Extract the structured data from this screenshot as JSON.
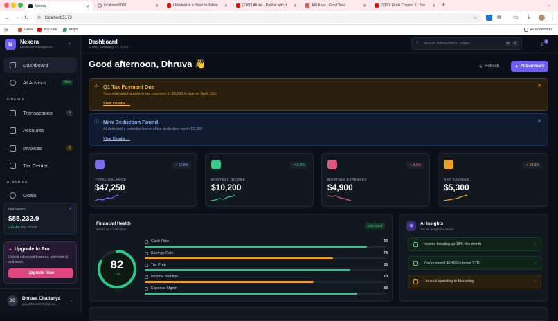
{
  "browser": {
    "tabs": [
      {
        "title": "Nexora",
        "active": true,
        "icon": "nexora-icon"
      },
      {
        "title": "localhost:8000",
        "active": false,
        "icon": "globe-icon"
      },
      {
        "title": "I Worked at a Hotel for Billion",
        "active": false,
        "icon": "youtube-icon"
      },
      {
        "title": "(1360) Afusic - Pal Pal with d",
        "active": false,
        "icon": "youtube-icon"
      },
      {
        "title": "API Keys - GroqCloud",
        "active": false,
        "icon": "groq-icon"
      },
      {
        "title": "(1360) Ekaki Chapter 5 : The",
        "active": false,
        "icon": "youtube-icon"
      }
    ],
    "url": "localhost:5173",
    "bookmarks": [
      "Gmail",
      "YouTube",
      "Maps"
    ],
    "all_bookmarks": "All Bookmarks"
  },
  "sidebar": {
    "brand": "Nexora",
    "tagline": "Financial Intelligence",
    "items": [
      {
        "label": "Dashboard",
        "icon": "dashboard-icon",
        "active": true
      },
      {
        "label": "AI Advisor",
        "icon": "ai-advisor-icon",
        "badge": "New"
      },
      {
        "label": "Transactions",
        "icon": "transactions-icon",
        "badge": "5"
      },
      {
        "label": "Accounts",
        "icon": "accounts-icon"
      },
      {
        "label": "Invoices",
        "icon": "invoices-icon",
        "badge": "2"
      },
      {
        "label": "Tax Center",
        "icon": "tax-center-icon"
      },
      {
        "label": "Goals",
        "icon": "goals-icon"
      }
    ],
    "sections": {
      "finance": "FINANCE",
      "planning": "PLANNING"
    },
    "net_worth": {
      "label": "Net Worth",
      "value": "$85,232.9",
      "change": "+10.4%",
      "period": "this month"
    },
    "upgrade": {
      "title": "Upgrade to Pro",
      "text": "Unlock advanced features, unlimited AI, and more.",
      "button": "Upgrade Now"
    },
    "user": {
      "initials": "DC",
      "name": "Dhruva Chaitanya",
      "email": "gopaldhruv1975@gmail..."
    }
  },
  "header": {
    "title": "Dashboard",
    "date": "Friday, February 27, 2026",
    "search_placeholder": "Search transactions, pages...",
    "search_shortcut": [
      "⌘",
      "K"
    ],
    "notification_count": "3"
  },
  "greeting": "Good afternoon, Dhruva 👋",
  "actions": {
    "refresh": "Refresh",
    "ai_summary": "AI Summary"
  },
  "alerts": [
    {
      "title": "Q1 Tax Payment Due",
      "text": "Your estimated quarterly tax payment of $3,250 is due on April 15th",
      "link": "View Details →"
    },
    {
      "title": "New Deduction Found",
      "text": "AI detected a potential home office deduction worth $1,200",
      "link": "View Details →"
    }
  ],
  "stats": [
    {
      "label": "TOTAL BALANCE",
      "value": "$47,250",
      "change": "↗ 12.5%",
      "color": "#7c6cf0",
      "change_color": "#8fa0ff"
    },
    {
      "label": "MONTHLY INCOME",
      "value": "$10,200",
      "change": "↗ 8.2%",
      "color": "#35c98a",
      "change_color": "#3bd38a"
    },
    {
      "label": "MONTHLY EXPENSES",
      "value": "$4,900",
      "change": "↘ 5.3%",
      "color": "#e0577d",
      "change_color": "#ff6b8a"
    },
    {
      "label": "NET SAVINGS",
      "value": "$5,300",
      "change": "↗ 23.1%",
      "color": "#f0a020",
      "change_color": "#f5b23c"
    }
  ],
  "financial_health": {
    "title": "Financial Health",
    "subtitle": "Based on 5 indicators",
    "badge": "Very Good",
    "score": "82",
    "score_max": "/ 100",
    "score_fraction": 0.82,
    "metrics": [
      {
        "label": "Cash Flow",
        "value": "92",
        "pct": 92,
        "color": "#2fc68a"
      },
      {
        "label": "Savings Rate",
        "value": "78",
        "pct": 78,
        "color": "#f0a020"
      },
      {
        "label": "Tax Prep",
        "value": "85",
        "pct": 85,
        "color": "#2fc68a"
      },
      {
        "label": "Income Stability",
        "value": "70",
        "pct": 70,
        "color": "#f0a020"
      },
      {
        "label": "Expense Mgmt",
        "value": "88",
        "pct": 88,
        "color": "#2fc68a"
      }
    ]
  },
  "ai_insights": {
    "title": "AI Insights",
    "subtitle": "Tap an insight for details",
    "items": [
      {
        "text": "Income trending up 15% this month",
        "type": "positive"
      },
      {
        "text": "You've saved $2,400 in taxes YTD",
        "type": "positive"
      },
      {
        "text": "Unusual spending in Marketing",
        "type": "warning"
      }
    ]
  }
}
